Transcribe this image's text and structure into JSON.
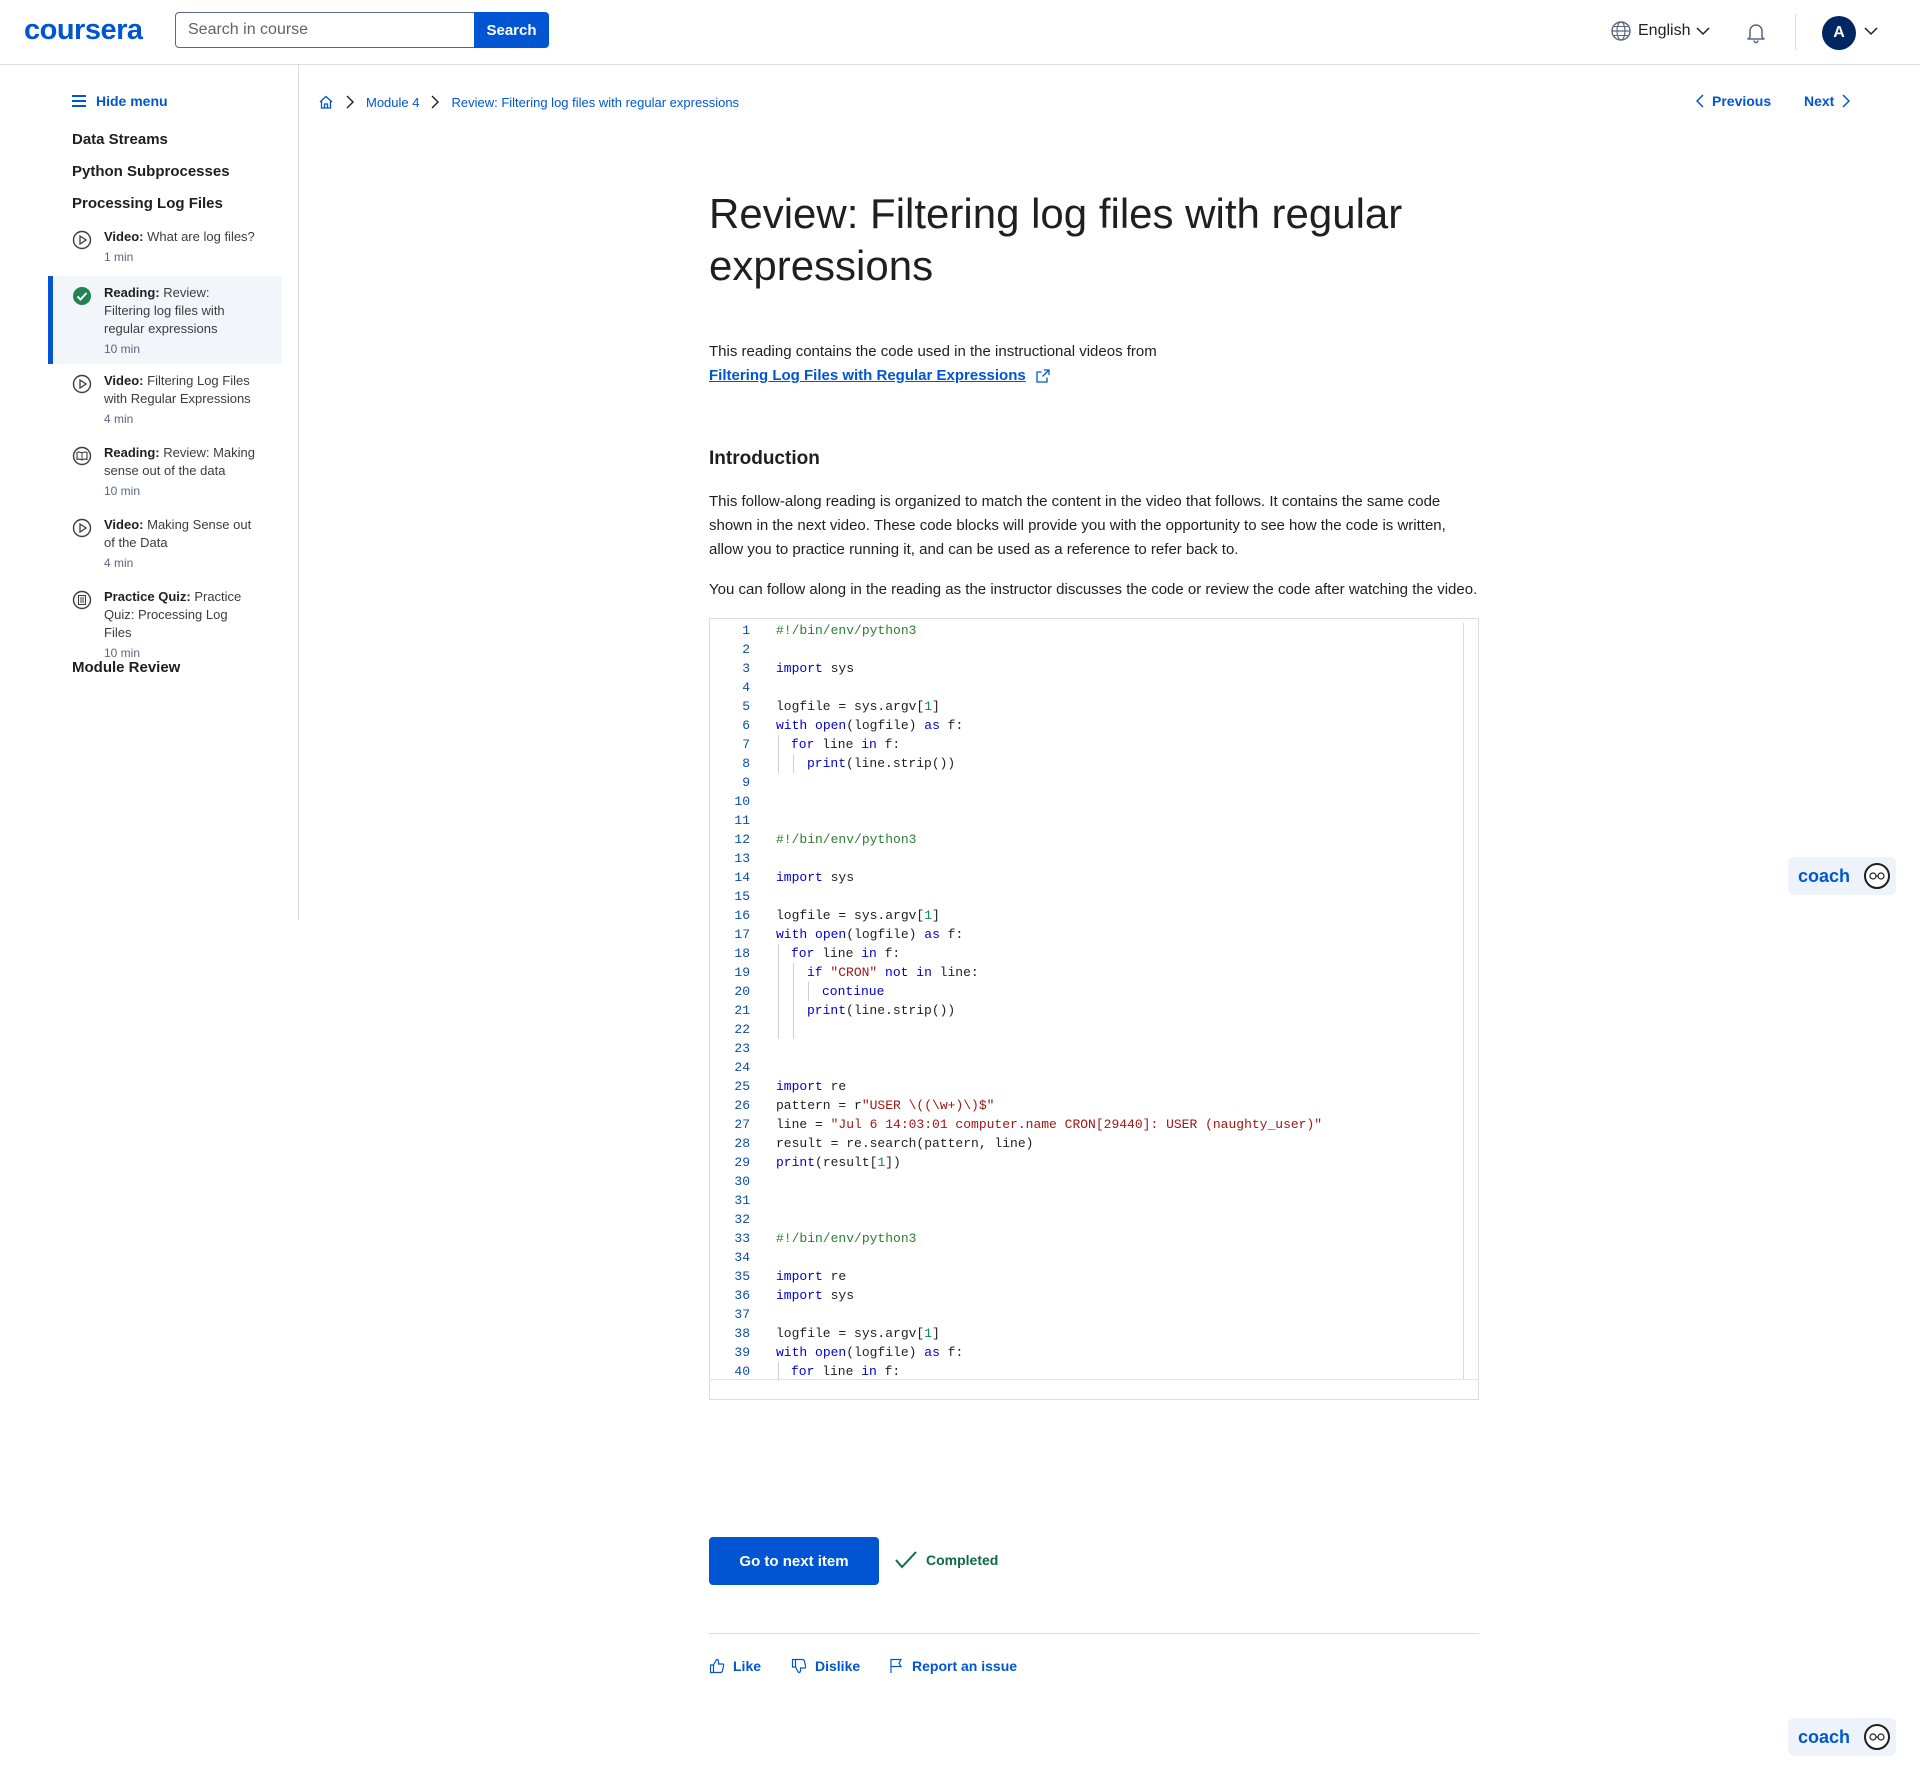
{
  "header": {
    "logo": "coursera",
    "search_placeholder": "Search in course",
    "search_button": "Search",
    "language": "English",
    "avatar_initial": "A"
  },
  "sidebar": {
    "hide_menu": "Hide menu",
    "sections": [
      "Data Streams",
      "Python Subprocesses",
      "Processing Log Files",
      "Module Review"
    ],
    "items": [
      {
        "type": "Video:",
        "title": "What are log files?",
        "duration": "1 min",
        "icon": "play-circle-icon"
      },
      {
        "type": "Reading:",
        "title": "Review: Filtering log files with regular expressions",
        "duration": "10 min",
        "icon": "check-circle-icon"
      },
      {
        "type": "Video:",
        "title": "Filtering Log Files with Regular Expressions",
        "duration": "4 min",
        "icon": "play-circle-icon"
      },
      {
        "type": "Reading:",
        "title": "Review: Making sense out of the data",
        "duration": "10 min",
        "icon": "book-icon"
      },
      {
        "type": "Video:",
        "title": "Making Sense out of the Data",
        "duration": "4 min",
        "icon": "play-circle-icon"
      },
      {
        "type": "Practice Quiz:",
        "title": "Practice Quiz: Processing Log Files",
        "duration": "10 min",
        "icon": "quiz-icon"
      }
    ]
  },
  "breadcrumb": {
    "module": "Module 4",
    "current": "Review: Filtering log files with regular expressions"
  },
  "nav": {
    "previous": "Previous",
    "next": "Next"
  },
  "content": {
    "title": "Review: Filtering log files with regular expressions",
    "intro": "This reading contains the code used in the instructional videos from",
    "link": "Filtering Log Files with Regular Expressions",
    "section_heading": "Introduction",
    "para1_line1": "This follow-along reading is organized to match the content in the video that follows. It contains the same code",
    "para1_line2": "shown in the next video. These code blocks will provide you with the opportunity to see how the code is written,",
    "para1_line3": "allow you to practice running it, and can be used as a reference to refer back to.",
    "para2": "You can follow along in the reading as the instructor discusses the code or review the code after watching the video."
  },
  "code": {
    "line_numbers": [
      "1",
      "2",
      "3",
      "4",
      "5",
      "6",
      "7",
      "8",
      "9",
      "10",
      "11",
      "12",
      "13",
      "14",
      "15",
      "16",
      "17",
      "18",
      "19",
      "20",
      "21",
      "22",
      "23",
      "24",
      "25",
      "26",
      "27",
      "28",
      "29",
      "30",
      "31",
      "32",
      "33",
      "34",
      "35",
      "36",
      "37",
      "38",
      "39",
      "40"
    ],
    "tokens": {
      "shebang": "#!/bin/env/python3",
      "import": "import",
      "sys": " sys",
      "re": " re",
      "logfile_a": "logfile = sys.argv[",
      "one": "1",
      "close_bracket": "]",
      "with": "with",
      "open": "open",
      "logfile_b": "(logfile) ",
      "as": "as",
      "f_colon": " f:",
      "for": "for",
      "line_sp": " line ",
      "in": "in",
      "print": "print",
      "strip": "(line.strip())",
      "if": "if",
      "cron": "\"CRON\"",
      "not": "not",
      "line_colon": " line:",
      "continue": "continue",
      "pattern_a": "pattern = r",
      "pattern_str": "\"USER \\((\\w+)\\)$\"",
      "line_eq": "line = ",
      "line_str": "\"Jul 6 14:03:01 computer.name CRON[29440]: USER (naughty_user)\"",
      "result": "result = re.search(pattern, line)",
      "print_result": "(result[",
      "close_paren": "])"
    }
  },
  "actions": {
    "next_item": "Go to next item",
    "completed": "Completed",
    "like": "Like",
    "dislike": "Dislike",
    "report": "Report an issue",
    "coach": "coach"
  },
  "colors": {
    "brand": "#0056d2",
    "success": "#0b6b43"
  }
}
